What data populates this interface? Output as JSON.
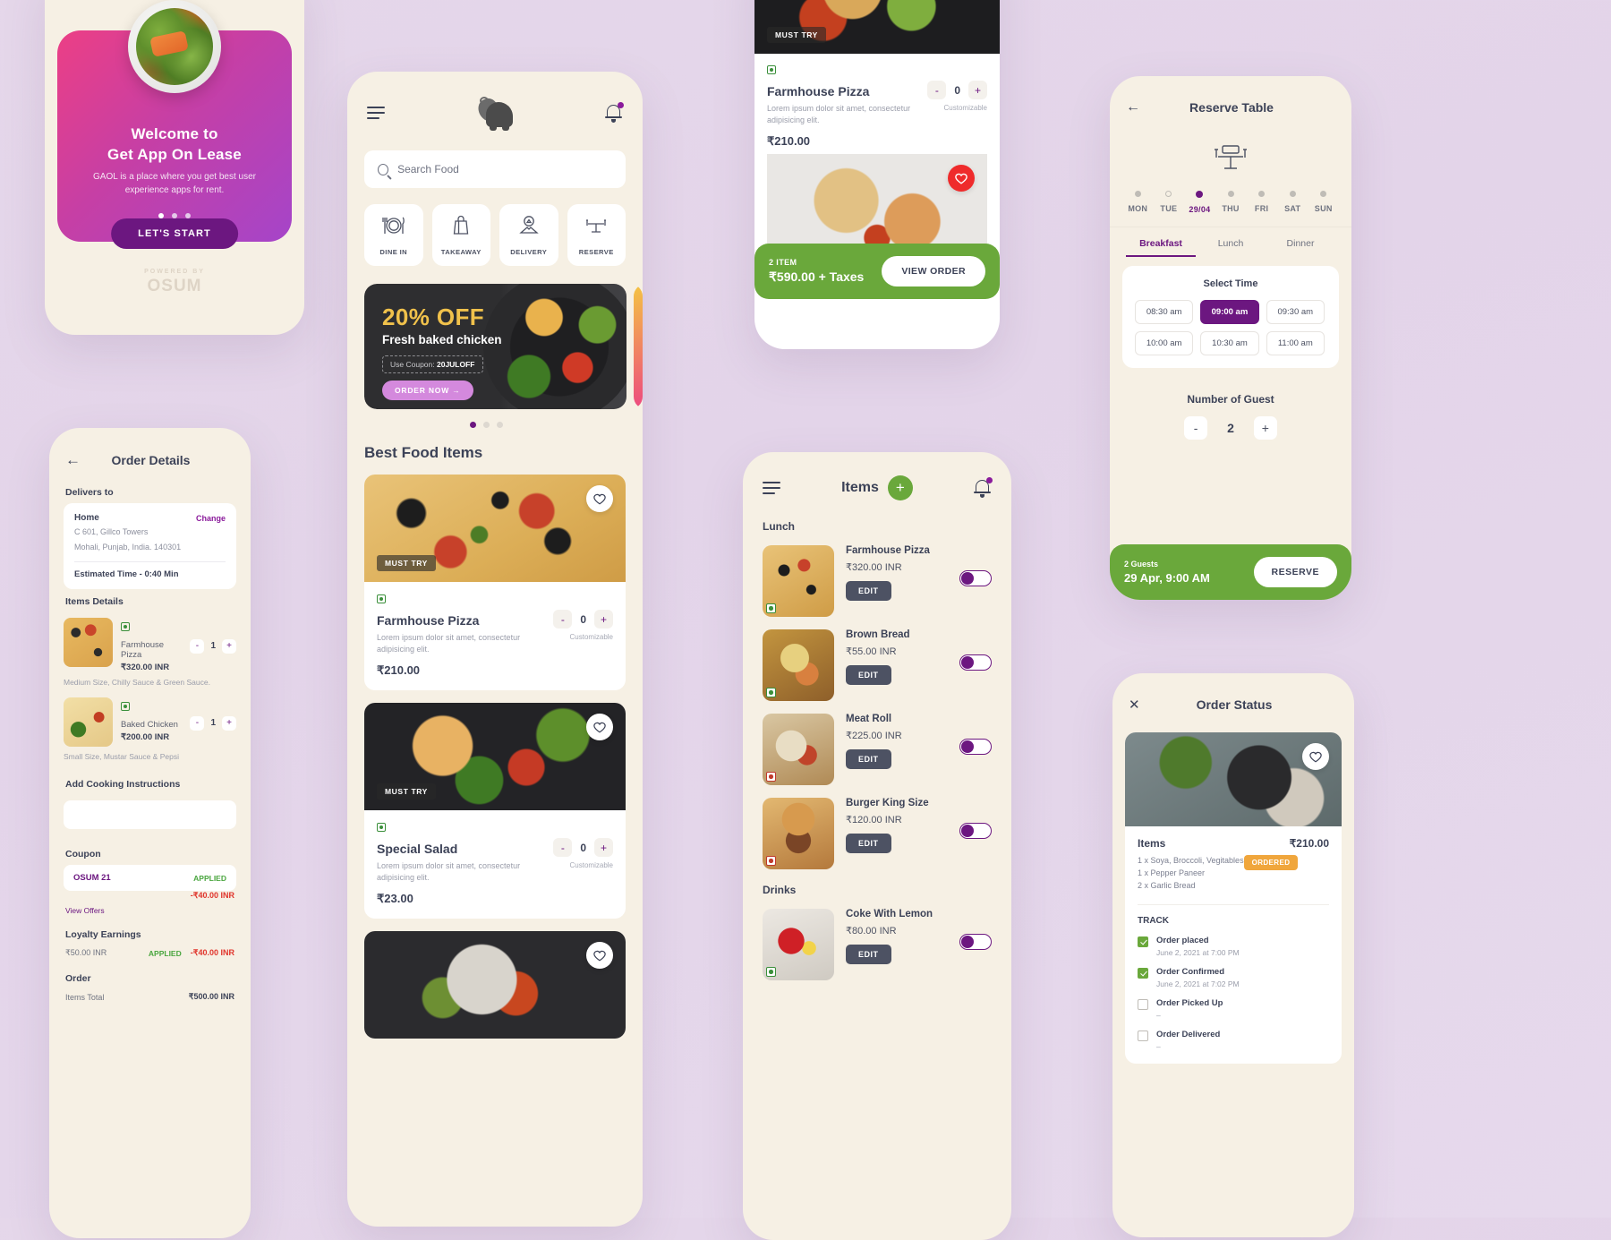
{
  "onboarding": {
    "title_line1": "Welcome to",
    "title_line2": "Get App On Lease",
    "subtitle": "GAOL is a place where you get best user experience apps for rent.",
    "cta": "LET'S START",
    "powered_by": "POWERED BY",
    "brand": "OSUM"
  },
  "order_details": {
    "title": "Order Details",
    "back_icon": "arrow-left-icon",
    "delivers_to_label": "Delivers to",
    "address": {
      "name": "Home",
      "change": "Change",
      "line1": "C 601, Gillco Towers",
      "line2": "Mohali, Punjab, India. 140301",
      "estimated": "Estimated Time - 0:40 Min"
    },
    "items_label": "Items Details",
    "items": [
      {
        "name": "Farmhouse Pizza",
        "price": "₹320.00 INR",
        "qty": "1",
        "desc": "Medium Size, Chilly Sauce & Green Sauce."
      },
      {
        "name": "Baked Chicken",
        "price": "₹200.00 INR",
        "qty": "1",
        "desc": "Small Size, Mustar Sauce & Pepsi"
      }
    ],
    "cooking_label": "Add Cooking Instructions",
    "cooking_value": "",
    "coupon_label": "Coupon",
    "coupon": {
      "code": "OSUM 21",
      "status": "APPLIED",
      "discount": "-₹40.00 INR"
    },
    "view_offers": "View Offers",
    "loyalty_label": "Loyalty Earnings",
    "loyalty": {
      "amount": "₹50.00 INR",
      "status": "APPLIED",
      "discount": "-₹40.00 INR"
    },
    "order_label": "Order",
    "order_rows": [
      {
        "label": "Items Total",
        "value": "₹500.00 INR"
      }
    ]
  },
  "home": {
    "menu_icon": "hamburger-menu-icon",
    "logo_icon": "elephant-logo-icon",
    "bell_icon": "notification-bell-icon",
    "search_placeholder": "Search Food",
    "search_value": "",
    "categories": [
      {
        "label": "DINE IN",
        "icon": "cutlery-plate-icon"
      },
      {
        "label": "TAKEAWAY",
        "icon": "shopping-bag-icon"
      },
      {
        "label": "DELIVERY",
        "icon": "delivery-map-icon"
      },
      {
        "label": "RESERVE",
        "icon": "table-chairs-icon"
      }
    ],
    "banner": {
      "discount": "20% OFF",
      "subtitle": "Fresh baked chicken",
      "coupon_prefix": "Use Coupon: ",
      "coupon_code": "20JULOFF",
      "cta": "ORDER NOW",
      "dots": 3,
      "active_dot": 0
    },
    "section_title": "Best Food Items",
    "foods": [
      {
        "tag": "MUST TRY",
        "name": "Farmhouse Pizza",
        "desc": "Lorem ipsum dolor sit amet, consectetur adipisicing elit.",
        "price": "₹210.00",
        "qty": "0",
        "customizable": "Customizable"
      },
      {
        "tag": "MUST TRY",
        "name": "Special Salad",
        "desc": "Lorem ipsum dolor sit amet, consectetur adipisicing elit.",
        "price": "₹23.00",
        "qty": "0",
        "customizable": "Customizable"
      }
    ]
  },
  "cart_screen": {
    "tag": "MUST TRY",
    "item": {
      "name": "Farmhouse Pizza",
      "desc": "Lorem ipsum dolor sit amet, consectetur adipisicing elit.",
      "price": "₹210.00",
      "qty": "0",
      "customizable": "Customizable"
    },
    "tag2": "MUST TRY",
    "bar": {
      "count": "2 ITEM",
      "total": "₹590.00 + Taxes",
      "cta": "VIEW ORDER"
    }
  },
  "items_screen": {
    "menu_icon": "hamburger-menu-icon",
    "title": "Items",
    "add_icon": "plus-icon",
    "bell_icon": "notification-bell-icon",
    "sections": [
      {
        "name": "Lunch",
        "rows": [
          {
            "name": "Farmhouse Pizza",
            "price": "₹320.00 INR",
            "edit": "EDIT",
            "veg": true,
            "thumb": "t-pizza"
          },
          {
            "name": "Brown Bread",
            "price": "₹55.00 INR",
            "edit": "EDIT",
            "veg": true,
            "thumb": "t-bread"
          },
          {
            "name": "Meat Roll",
            "price": "₹225.00 INR",
            "edit": "EDIT",
            "veg": false,
            "thumb": "t-roll"
          },
          {
            "name": "Burger King Size",
            "price": "₹120.00 INR",
            "edit": "EDIT",
            "veg": false,
            "thumb": "t-burger"
          }
        ]
      },
      {
        "name": "Drinks",
        "rows": [
          {
            "name": "Coke With Lemon",
            "price": "₹80.00 INR",
            "edit": "EDIT",
            "veg": true,
            "thumb": "t-coke"
          }
        ]
      }
    ]
  },
  "reserve": {
    "title": "Reserve Table",
    "back_icon": "arrow-left-icon",
    "table_icon": "table-chairs-icon",
    "days": [
      {
        "label": "MON",
        "state": "dot"
      },
      {
        "label": "TUE",
        "state": "hollow"
      },
      {
        "label": "29/04",
        "state": "active"
      },
      {
        "label": "THU",
        "state": "dot"
      },
      {
        "label": "FRI",
        "state": "dot"
      },
      {
        "label": "SAT",
        "state": "dot"
      },
      {
        "label": "SUN",
        "state": "dot"
      }
    ],
    "meals": [
      "Breakfast",
      "Lunch",
      "Dinner"
    ],
    "active_meal": "Breakfast",
    "select_time_label": "Select Time",
    "times": [
      "08:30 am",
      "09:00 am",
      "09:30 am",
      "10:00 am",
      "10:30 am",
      "11:00 am"
    ],
    "selected_time": "09:00 am",
    "guests_label": "Number of Guest",
    "guests_value": "2",
    "bar": {
      "guests": "2 Guests",
      "when": "29 Apr, 9:00 AM",
      "cta": "RESERVE"
    }
  },
  "order_status": {
    "title": "Order Status",
    "close_icon": "close-icon",
    "heart_icon": "heart-icon",
    "items_label": "Items",
    "amount": "₹210.00",
    "lines": [
      "1 x Soya, Broccoli, Vegitables",
      "1 x Pepper Paneer",
      "2 x Garlic Bread"
    ],
    "badge": "ORDERED",
    "track_label": "TRACK",
    "steps": [
      {
        "label": "Order placed",
        "time": "June 2, 2021 at 7:00 PM",
        "done": true
      },
      {
        "label": "Order Confirmed",
        "time": "June 2, 2021 at 7:02 PM",
        "done": true
      },
      {
        "label": "Order Picked Up",
        "time": "–",
        "done": false
      },
      {
        "label": "Order Delivered",
        "time": "–",
        "done": false
      }
    ]
  }
}
